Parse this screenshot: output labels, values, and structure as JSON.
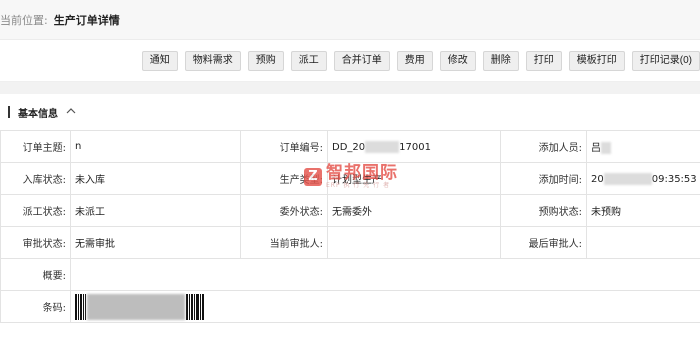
{
  "breadcrumb": {
    "label": "当前位置:",
    "title": "生产订单详情"
  },
  "toolbar": {
    "buttons": [
      "通知",
      "物料需求",
      "预购",
      "派工",
      "合并订单",
      "费用",
      "修改",
      "删除",
      "打印",
      "模板打印",
      "打印记录(0)"
    ]
  },
  "section": {
    "title": "基本信息",
    "toggle_icon": "chevron-up-icon"
  },
  "fields": {
    "order_subject": {
      "label": "订单主题:",
      "value": "n"
    },
    "order_no": {
      "label": "订单编号:",
      "value_prefix": "DD_20",
      "value_suffix": "17001"
    },
    "created_by": {
      "label": "添加人员:",
      "value": "吕"
    },
    "stock_status": {
      "label": "入库状态:",
      "value": "未入库"
    },
    "production_type": {
      "label": "生产类型:",
      "value": "计划型生产"
    },
    "created_at": {
      "label": "添加时间:",
      "value_prefix": "20",
      "value_suffix": "09:35:53"
    },
    "dispatch_status": {
      "label": "派工状态:",
      "value": "未派工"
    },
    "outsource_status": {
      "label": "委外状态:",
      "value": "无需委外"
    },
    "preorder_status": {
      "label": "预购状态:",
      "value": "未预购"
    },
    "approval_status": {
      "label": "审批状态:",
      "value": "无需审批"
    },
    "current_approver": {
      "label": "当前审批人:",
      "value": ""
    },
    "last_approver": {
      "label": "最后审批人:",
      "value": ""
    },
    "summary": {
      "label": "概要:",
      "value": ""
    },
    "barcode": {
      "label": "条码:"
    }
  },
  "watermark": {
    "main": "智邦国际",
    "sub": "ERP 执 行 先 行 者",
    "logo": "Z"
  },
  "colors": {
    "watermark": "#e5534b",
    "button_bg": "#efefef",
    "border": "#e3e3e3"
  }
}
